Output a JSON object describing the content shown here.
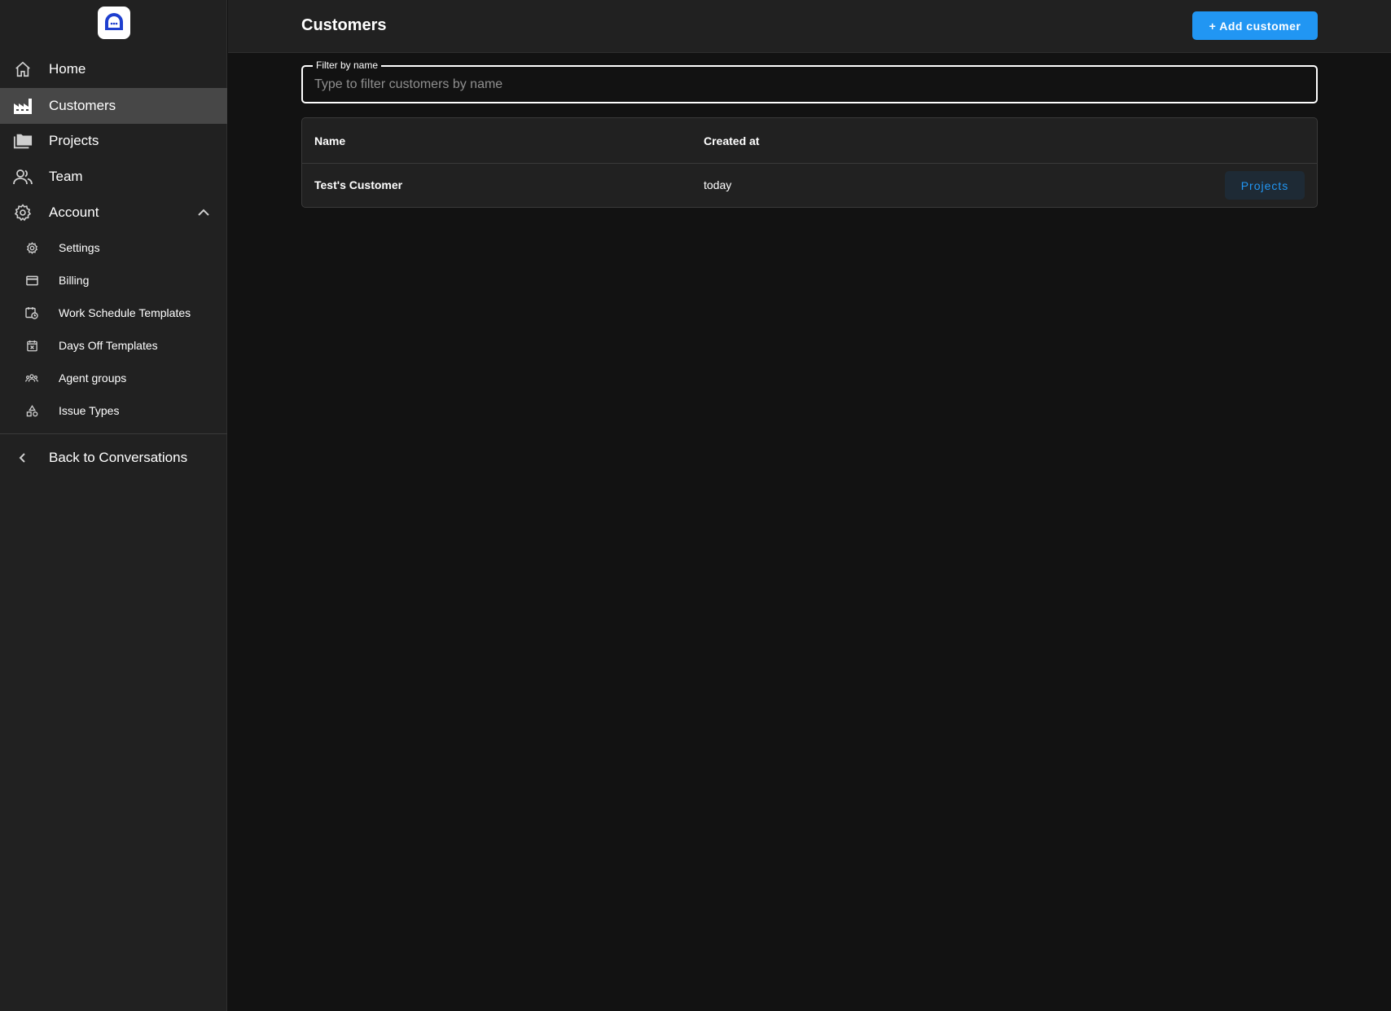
{
  "sidebar": {
    "nav": [
      {
        "label": "Home",
        "icon": "home-icon"
      },
      {
        "label": "Customers",
        "icon": "factory-icon",
        "active": true
      },
      {
        "label": "Projects",
        "icon": "folders-icon"
      },
      {
        "label": "Team",
        "icon": "people-icon"
      },
      {
        "label": "Account",
        "icon": "gear-icon",
        "expanded": true
      }
    ],
    "account_items": [
      {
        "label": "Settings",
        "icon": "cog-icon"
      },
      {
        "label": "Billing",
        "icon": "credit-card-icon"
      },
      {
        "label": "Work Schedule Templates",
        "icon": "calendar-clock-icon"
      },
      {
        "label": "Days Off Templates",
        "icon": "calendar-x-icon"
      },
      {
        "label": "Agent groups",
        "icon": "group-icon"
      },
      {
        "label": "Issue Types",
        "icon": "shapes-icon"
      }
    ],
    "back": {
      "label": "Back to Conversations",
      "icon": "chevron-left-icon"
    }
  },
  "header": {
    "title": "Customers",
    "add_button": "+ Add customer"
  },
  "filter": {
    "label": "Filter by name",
    "placeholder": "Type to filter customers by name",
    "value": ""
  },
  "table": {
    "columns": [
      "Name",
      "Created at"
    ],
    "rows": [
      {
        "name": "Test's Customer",
        "created_at": "today",
        "action": "Projects"
      }
    ]
  },
  "colors": {
    "accent": "#2196f3",
    "sidebar_bg": "#212121",
    "page_bg": "#121212",
    "active_item_bg": "#474747",
    "logo_blue": "#1e3fcf"
  }
}
